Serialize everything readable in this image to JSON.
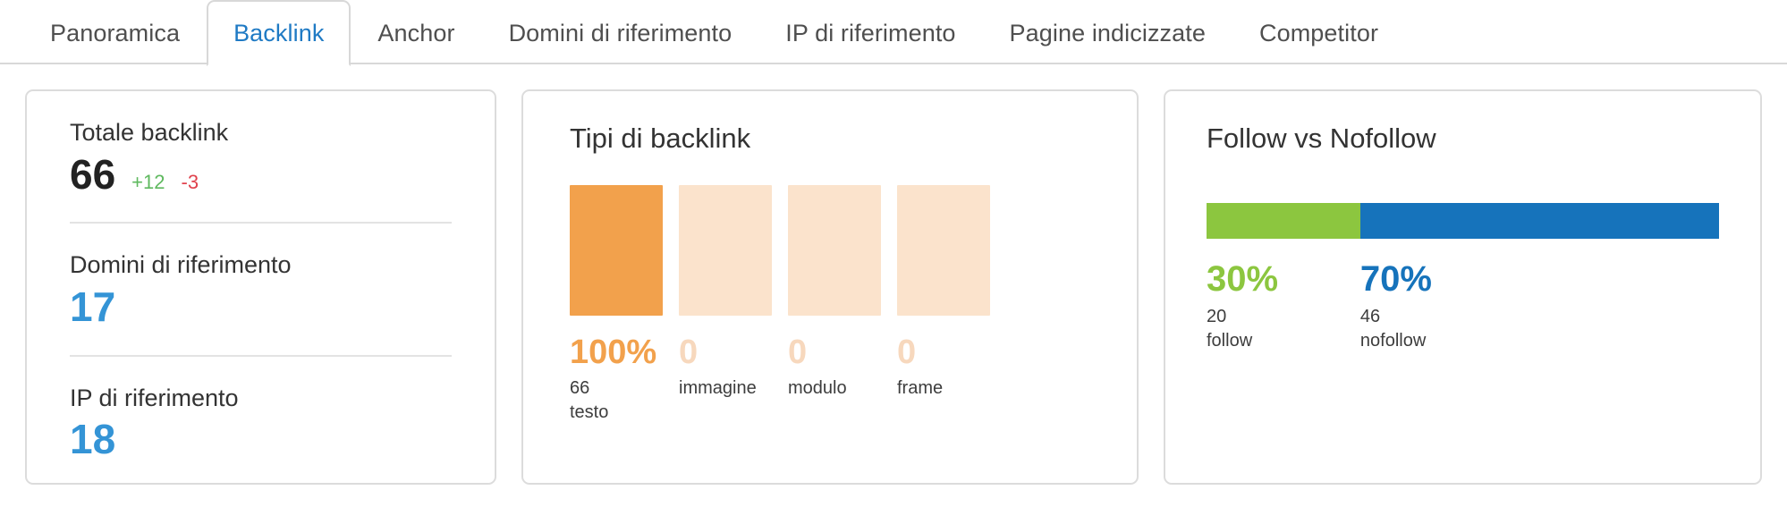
{
  "tabs": [
    {
      "label": "Panoramica",
      "active": false
    },
    {
      "label": "Backlink",
      "active": true
    },
    {
      "label": "Anchor",
      "active": false
    },
    {
      "label": "Domini di riferimento",
      "active": false
    },
    {
      "label": "IP di riferimento",
      "active": false
    },
    {
      "label": "Pagine indicizzate",
      "active": false
    },
    {
      "label": "Competitor",
      "active": false
    }
  ],
  "colors": {
    "active_tab": "#1f7ac4",
    "blue_metric": "#3494d6",
    "delta_up": "#5fb95f",
    "delta_down": "#e0424d",
    "orange_strong": "#f2a14c",
    "orange_pale": "#fbe3cc",
    "orange_pale_text": "#f7d8bd",
    "green": "#8cc63f",
    "blue": "#1673bb"
  },
  "summary_card": {
    "metrics": [
      {
        "label": "Totale backlink",
        "value": "66",
        "value_color": "dark",
        "delta_up": "+12",
        "delta_down": "-3"
      },
      {
        "label": "Domini di riferimento",
        "value": "17",
        "value_color": "blue",
        "delta_up": "",
        "delta_down": ""
      },
      {
        "label": "IP di riferimento",
        "value": "18",
        "value_color": "blue",
        "delta_up": "",
        "delta_down": ""
      }
    ]
  },
  "types_card": {
    "title": "Tipi di backlink",
    "chart_data": {
      "type": "bar",
      "title": "Tipi di backlink",
      "categories": [
        "testo",
        "immagine",
        "modulo",
        "frame"
      ],
      "values": [
        66,
        0,
        0,
        0
      ],
      "percents": [
        "100%",
        "0",
        "0",
        "0"
      ],
      "counts": [
        "66",
        "",
        "",
        ""
      ],
      "ylim": [
        0,
        66
      ],
      "grid": false,
      "xlabel": "",
      "ylabel": ""
    },
    "bars": [
      {
        "pct": "100%",
        "count": "66",
        "name": "testo",
        "fill": "#f2a14c",
        "pct_color": "#f2a14c",
        "height_pct": 100
      },
      {
        "pct": "0",
        "count": "",
        "name": "immagine",
        "fill": "#fbe3cc",
        "pct_color": "#f7d8bd",
        "height_pct": 100
      },
      {
        "pct": "0",
        "count": "",
        "name": "modulo",
        "fill": "#fbe3cc",
        "pct_color": "#f7d8bd",
        "height_pct": 100
      },
      {
        "pct": "0",
        "count": "",
        "name": "frame",
        "fill": "#fbe3cc",
        "pct_color": "#f7d8bd",
        "height_pct": 100
      }
    ]
  },
  "follow_card": {
    "title": "Follow vs Nofollow",
    "chart_data": {
      "type": "bar",
      "title": "Follow vs Nofollow",
      "categories": [
        "follow",
        "nofollow"
      ],
      "values": [
        20,
        46
      ],
      "percents": [
        30,
        70
      ],
      "grid": false,
      "xlabel": "",
      "ylabel": ""
    },
    "segments": [
      {
        "pct": "30%",
        "count": "20",
        "name": "follow",
        "color": "#8cc63f",
        "width_pct": 30
      },
      {
        "pct": "70%",
        "count": "46",
        "name": "nofollow",
        "color": "#1673bb",
        "width_pct": 70
      }
    ]
  }
}
